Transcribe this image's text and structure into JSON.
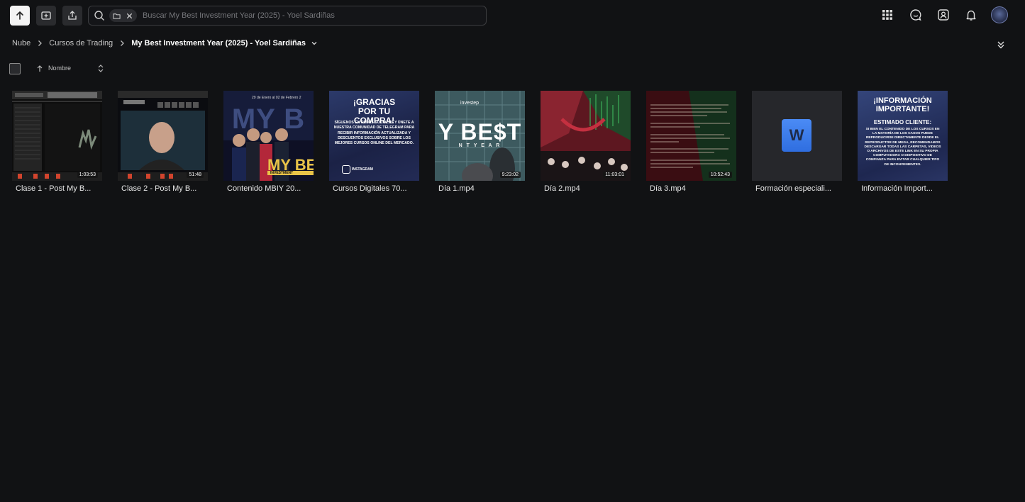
{
  "toolbar": {
    "search_placeholder": "Buscar My Best Investment Year (2025) - Yoel Sardiñas"
  },
  "breadcrumb": {
    "items": [
      "Nube",
      "Cursos de Trading"
    ],
    "current": "My Best Investment Year (2025) - Yoel Sardiñas"
  },
  "sort": {
    "label": "Nombre"
  },
  "files": [
    {
      "name": "Clase 1 - Post My B...",
      "duration": "1:03:53"
    },
    {
      "name": "Clase 2 - Post My B...",
      "duration": "51:48"
    },
    {
      "name": "Contenido MBIY 20...",
      "duration": "",
      "thumb_text_top": "29 de Enero al 02 de Febrero 2",
      "thumb_text_big": "MY B",
      "thumb_text_bot": "MY BE",
      "thumb_text_sub": "INVESTMENT"
    },
    {
      "name": "Cursos Digitales 70...",
      "duration": "",
      "thumb_title": "¡GRACIAS POR TU COMPRA!",
      "thumb_body": "SÍGUENOS EN REDES SOCIALES Y ÚNETE A NUESTRA COMUNIDAD DE TELEGRAM PARA RECIBIR INFORMACIÓN ACTUALIZADA Y DESCUENTOS EXCLUSIVOS SOBRE LOS MEJORES CURSOS ONLINE DEL MERCADO.",
      "thumb_footer": "INSTAGRAM"
    },
    {
      "name": "Día 1.mp4",
      "duration": "9:23:02",
      "thumb_text": "Y BE$T",
      "thumb_sub": "N T   Y E A R",
      "thumb_brand": "investep"
    },
    {
      "name": "Día 2.mp4",
      "duration": "11:03:01"
    },
    {
      "name": "Día 3.mp4",
      "duration": "10:52:43"
    },
    {
      "name": "Formación especiali...",
      "duration": "",
      "thumb_icon_letter": "W"
    },
    {
      "name": "Información Import...",
      "duration": "",
      "thumb_title": "¡INFORMACIÓN IMPORTANTE!",
      "thumb_subtitle": "ESTIMADO CLIENTE:",
      "thumb_body": "SI BIEN EL CONTENIDO DE LOS CURSOS EN LA MAYORÍA DE LOS CASOS PUEDE REPRODUCIRSE DIRECTAMENTE DESDE EL REPRODUCTOR DE MEGA, RECOMENDAMOS DESCARGAR TODAS LAS CARPETAS, VIDEOS O ARCHIVOS DE ESTE LINK EN SU PROPIA COMPUTADORA O DISPOSITIVO DE CONFIANZA PARA EVITAR CUALQUIER TIPO DE INCONVENIENTES."
    }
  ],
  "colors": {
    "background": "#111214",
    "accent_word": "#4b8bf5",
    "avatar_border": "#6c79a8"
  }
}
